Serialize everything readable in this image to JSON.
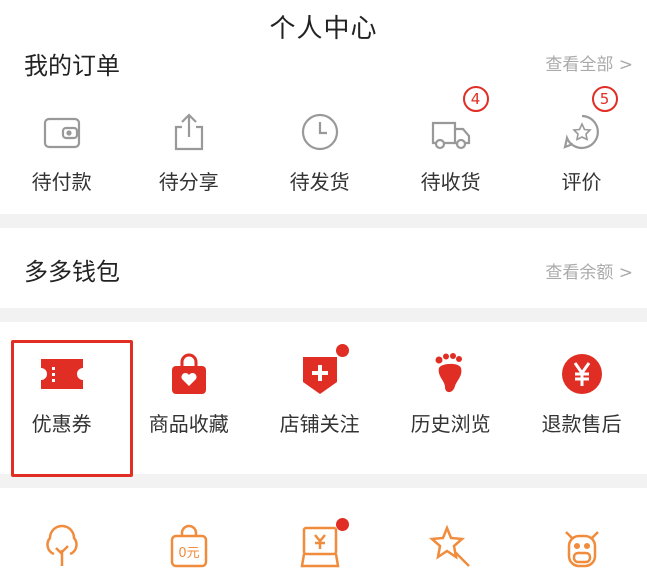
{
  "header": {
    "title": "个人中心"
  },
  "orders": {
    "title": "我的订单",
    "view_all": "查看全部 >",
    "items": [
      {
        "label": "待付款",
        "icon": "wallet-icon"
      },
      {
        "label": "待分享",
        "icon": "share-icon"
      },
      {
        "label": "待发货",
        "icon": "clock-icon"
      },
      {
        "label": "待收货",
        "icon": "truck-icon",
        "badge": "4"
      },
      {
        "label": "评价",
        "icon": "review-icon",
        "badge": "5"
      }
    ]
  },
  "wallet": {
    "title": "多多钱包",
    "link": "查看余额 >"
  },
  "services": {
    "items": [
      {
        "label": "优惠券",
        "icon": "coupon-icon",
        "highlighted": true
      },
      {
        "label": "商品收藏",
        "icon": "shopping-bag-heart-icon"
      },
      {
        "label": "店铺关注",
        "icon": "shop-plus-icon",
        "dot": true
      },
      {
        "label": "历史浏览",
        "icon": "footprint-icon"
      },
      {
        "label": "退款售后",
        "icon": "yuan-icon"
      }
    ]
  },
  "bottom_row": {
    "items": [
      {
        "icon": "tree-icon"
      },
      {
        "icon": "bag-zero-icon",
        "text": "0元"
      },
      {
        "icon": "yuan-card-icon",
        "dot": true
      },
      {
        "icon": "star-cursor-icon"
      },
      {
        "icon": "cow-icon"
      }
    ]
  },
  "colors": {
    "accent": "#e02e24",
    "orange": "#f08c3c",
    "gray_icon": "#999999"
  }
}
